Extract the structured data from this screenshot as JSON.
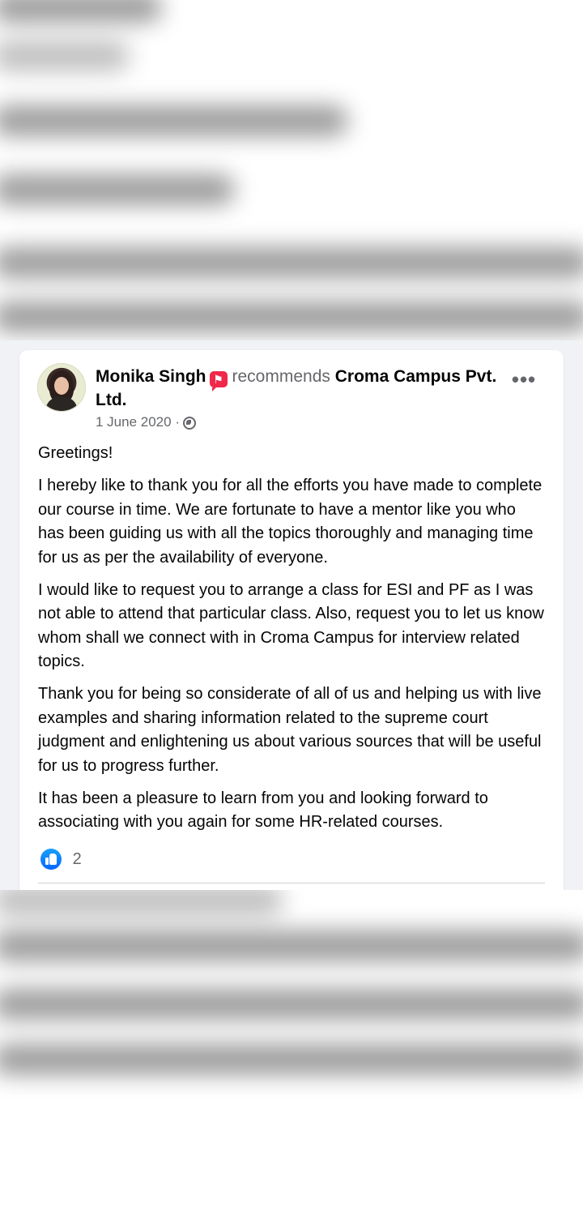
{
  "post": {
    "author": "Monika Singh",
    "action": "recommends",
    "page_name": "Croma Campus Pvt. Ltd.",
    "date": "1 June 2020",
    "date_separator": "·",
    "privacy_icon": "globe-icon",
    "more_icon": "more-options-icon",
    "badge_icon": "recommendation-badge-icon",
    "paragraphs": [
      "Greetings!",
      "I hereby like to thank you for all the efforts you have made to complete our course in time. We are fortunate to have a mentor like you who has been guiding us with all the topics thoroughly and managing time for us as per the availability of everyone.",
      "I would like to request you to arrange a class for ESI and PF as I was not able to attend that particular class. Also, request you to let us know whom shall we connect with in Croma Campus for interview related topics.",
      "Thank you for being so considerate of all of us and helping us with live examples and sharing information related to the supreme court judgment and enlightening us about various sources that will be useful for us to progress further.",
      "It has been a pleasure to learn from you and looking forward to associating with you again for some HR-related courses."
    ],
    "reactions": {
      "icon": "like-icon",
      "count": "2"
    }
  },
  "colors": {
    "badge": "#f02849",
    "like": "#0866ff",
    "secondary_text": "#65676b",
    "background": "#f0f2f5"
  }
}
